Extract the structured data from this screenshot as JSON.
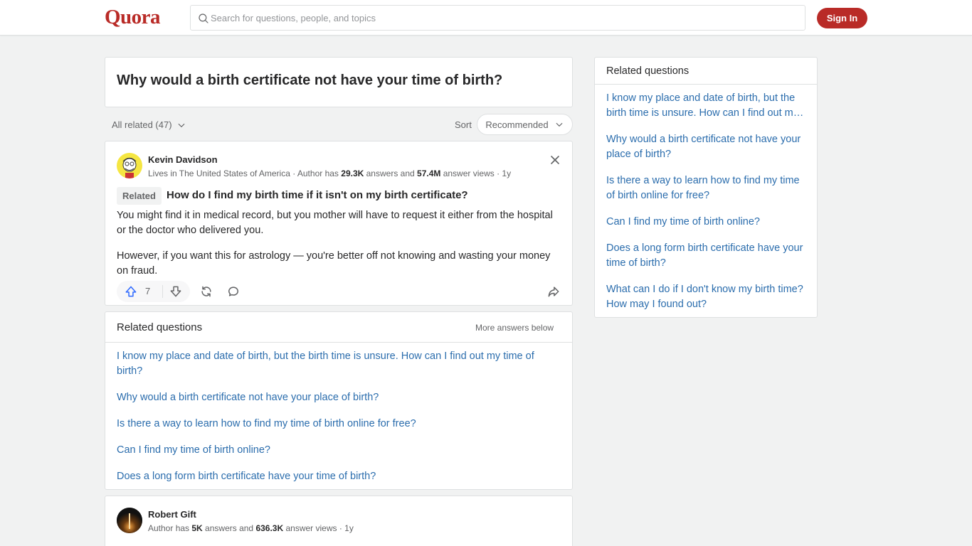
{
  "header": {
    "logo": "Quora",
    "search_placeholder": "Search for questions, people, and topics",
    "signin_label": "Sign In",
    "brand_color": "#b92b27"
  },
  "question": {
    "title": "Why would a birth certificate not have your time of birth?"
  },
  "filters": {
    "all_related": "All related (47)",
    "sort_label": "Sort",
    "sort_value": "Recommended"
  },
  "answer1": {
    "author": "Kevin Davidson",
    "meta_prefix": "Lives in The United States of America · Author has ",
    "answers": "29.3K",
    "meta_mid": " answers and ",
    "views": "57.4M",
    "meta_suffix": " answer views · 1y",
    "related_tag": "Related",
    "related_question": "How do I find my birth time if it isn't on my birth certificate?",
    "paragraphs": [
      "You might find it in medical record, but you mother will have to request it either from the hospital or the doctor who delivered you.",
      "However, if you want this for astrology — you're better off not knowing and wasting your money on fraud."
    ],
    "upvotes": "7"
  },
  "related_main": {
    "title": "Related questions",
    "more": "More answers below",
    "items": [
      "I know my place and date of birth, but the birth time is unsure. How can I find out my time of birth?",
      "Why would a birth certificate not have your place of birth?",
      "Is there a way to learn how to find my time of birth online for free?",
      "Can I find my time of birth online?",
      "Does a long form birth certificate have your time of birth?"
    ]
  },
  "answer2": {
    "author": "Robert Gift",
    "meta_prefix": "Author has ",
    "answers": "5K",
    "meta_mid": " answers and ",
    "views": "636.3K",
    "meta_suffix": " answer views · 1y"
  },
  "sidebar": {
    "title": "Related questions",
    "items": [
      "I know my place and date of birth, but the birth time is unsure. How can I find out my time of birth?",
      "Why would a birth certificate not have your place of birth?",
      "Is there a way to learn how to find my time of birth online for free?",
      "Can I find my time of birth online?",
      "Does a long form birth certificate have your time of birth?",
      "What can I do if I don't know my birth time? How may I found out?"
    ]
  }
}
